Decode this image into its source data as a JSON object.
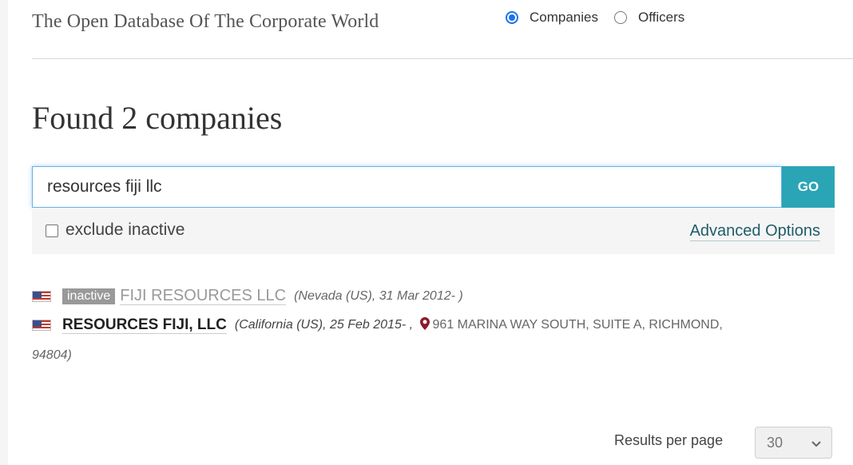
{
  "header": {
    "tagline": "The Open Database Of The Corporate World",
    "search_types": [
      {
        "label": "Companies",
        "checked": true
      },
      {
        "label": "Officers",
        "checked": false
      }
    ]
  },
  "main": {
    "heading": "Found 2 companies",
    "search": {
      "value": "resources fiji llc",
      "go_label": "GO"
    },
    "options": {
      "exclude_inactive_label": "exclude inactive",
      "exclude_inactive_checked": false,
      "advanced_options_label": "Advanced Options"
    },
    "results": [
      {
        "flag": "us-flag-icon",
        "status": "inactive",
        "name": "FIJI RESOURCES LLC",
        "meta": "(Nevada (US), 31 Mar 2012- )"
      },
      {
        "flag": "us-flag-icon",
        "name": "RESOURCES FIJI, LLC",
        "meta": "(California (US), 25 Feb 2015- ,",
        "address_icon": "map-pin-icon",
        "address": "961 MARINA WAY SOUTH, SUITE A, RICHMOND,",
        "address_cont": "94804)"
      }
    ],
    "pagination": {
      "results_per_page_label": "Results per page",
      "results_per_page_value": "30"
    }
  },
  "colors": {
    "accent": "#2aa5b5",
    "link": "#1f5d6a",
    "pin": "#8b1a2b",
    "badge": "#999999"
  }
}
